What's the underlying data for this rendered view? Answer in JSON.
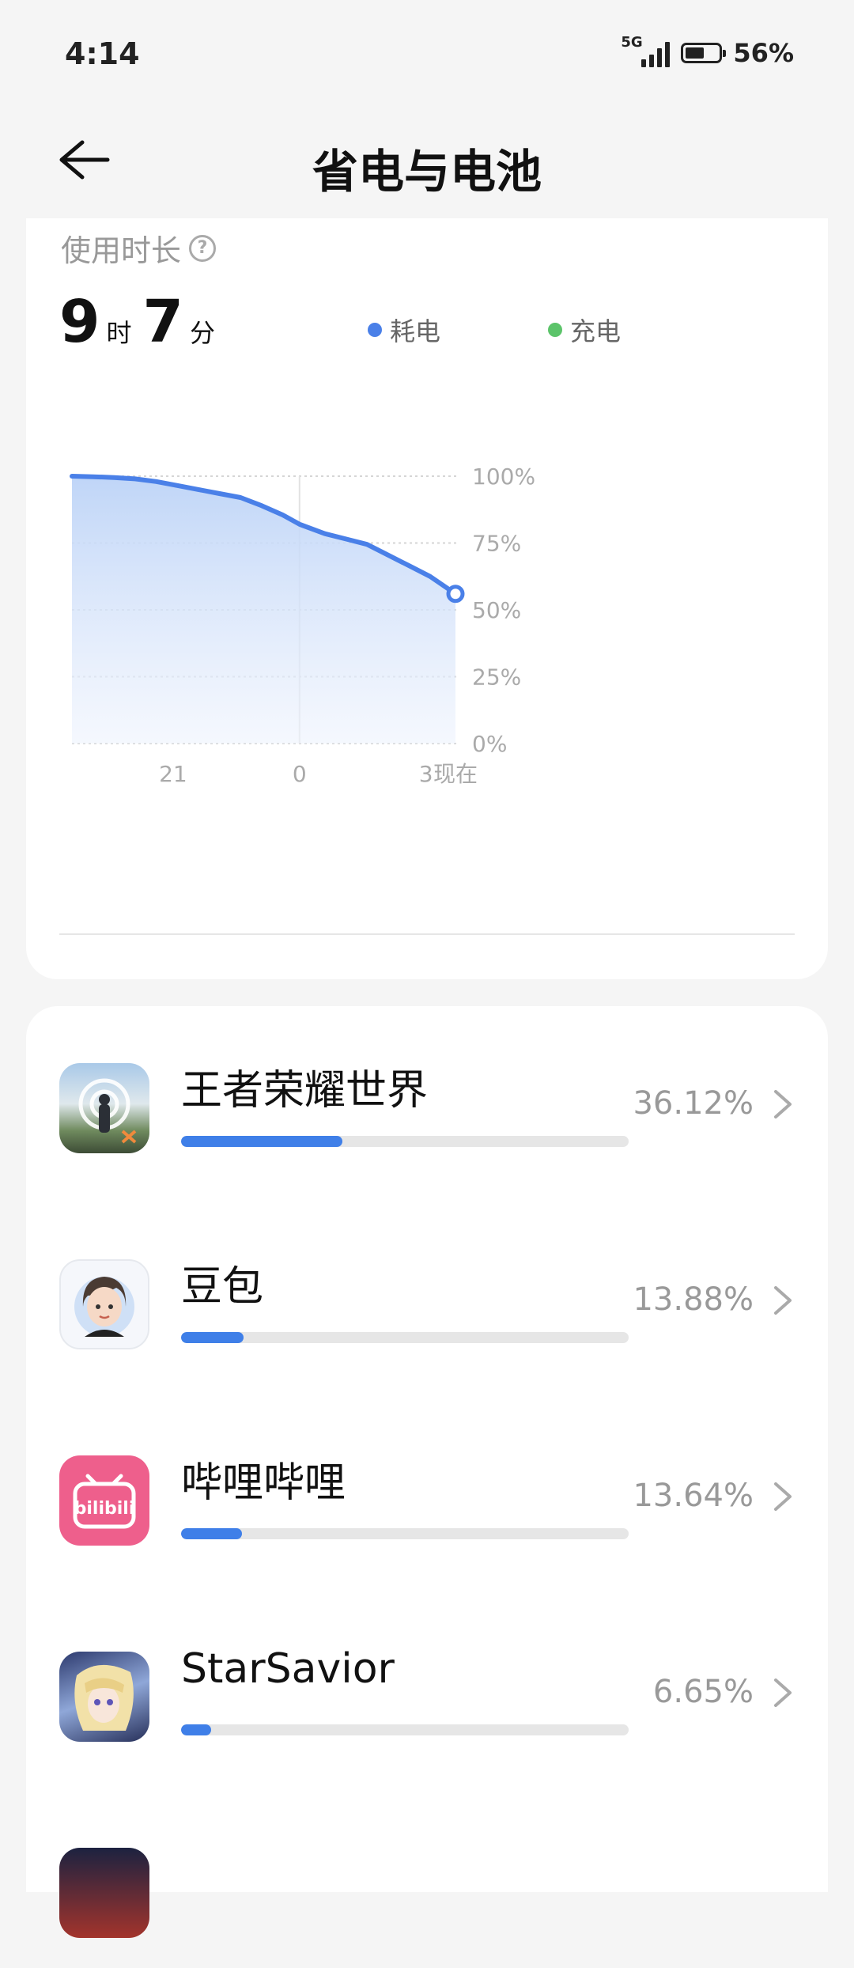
{
  "status": {
    "time": "4:14",
    "network": "5G",
    "battery_text": "56%",
    "battery_level": 0.56
  },
  "header": {
    "title": "省电与电池"
  },
  "usage": {
    "label": "使用时长",
    "hours": "9",
    "hours_unit": "时",
    "minutes": "7",
    "minutes_unit": "分",
    "legend": [
      {
        "label": "耗电",
        "color": "#4a80e8"
      },
      {
        "label": "充电",
        "color": "#5cc46a"
      }
    ]
  },
  "chart_data": {
    "type": "area",
    "title": "",
    "xlabel": "",
    "ylabel": "",
    "ylim": [
      0,
      100
    ],
    "y_ticks": [
      "100%",
      "75%",
      "50%",
      "25%",
      "0%"
    ],
    "x_ticks": [
      {
        "label": "21",
        "hours_from_start": 2.4
      },
      {
        "label": "0",
        "hours_from_start": 5.4
      },
      {
        "label": "3",
        "hours_from_start": 8.4
      },
      {
        "label": "现在",
        "hours_from_start": 9.1
      }
    ],
    "x": [
      0,
      0.5,
      1.0,
      1.5,
      2.0,
      2.5,
      3.0,
      3.5,
      4.0,
      4.5,
      5.0,
      5.4,
      6.0,
      6.5,
      7.0,
      7.5,
      8.0,
      8.5,
      9.1
    ],
    "series": [
      {
        "color": "#4a80e8",
        "values": [
          100,
          99.8,
          99.5,
          99.0,
          98.0,
          96.5,
          95.0,
          93.5,
          92.0,
          89.0,
          85.5,
          82.0,
          78.5,
          76.5,
          74.5,
          70.5,
          66.5,
          62.5,
          56.0
        ]
      }
    ]
  },
  "apps": [
    {
      "name": "王者荣耀世界",
      "percent": "36.12%",
      "share": 0.3612
    },
    {
      "name": "豆包",
      "percent": "13.88%",
      "share": 0.1388
    },
    {
      "name": "哔哩哔哩",
      "percent": "13.64%",
      "share": 0.1364
    },
    {
      "name": "StarSavior",
      "percent": "6.65%",
      "share": 0.0665
    }
  ],
  "bilibili_logo_text": "bilibili"
}
